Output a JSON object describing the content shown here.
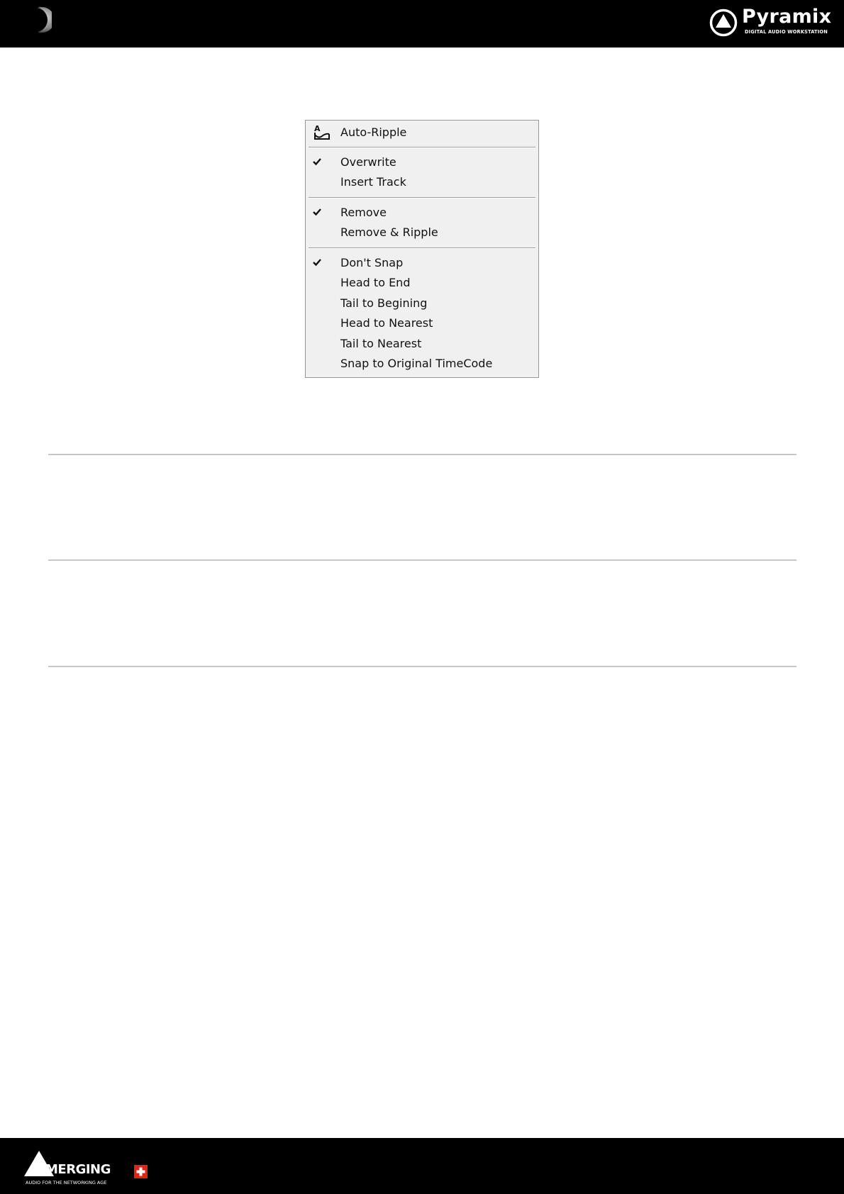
{
  "header": {
    "moon_icon": "moon-icon",
    "logo": {
      "name": "Pyramix",
      "tagline": "DIGITAL AUDIO WORKSTATION",
      "icon": "pyramix-triangle-icon"
    }
  },
  "menu": {
    "items": [
      {
        "label": "Auto-Ripple",
        "checked": false,
        "icon": "auto-ripple-icon"
      },
      {
        "label": "Overwrite",
        "checked": true
      },
      {
        "label": "Insert Track",
        "checked": false
      },
      {
        "label": "Remove",
        "checked": true
      },
      {
        "label": "Remove & Ripple",
        "checked": false
      },
      {
        "label": "Don't Snap",
        "checked": true
      },
      {
        "label": "Head to End",
        "checked": false
      },
      {
        "label": "Tail to Begining",
        "checked": false
      },
      {
        "label": "Head to Nearest",
        "checked": false
      },
      {
        "label": "Tail to Nearest",
        "checked": false
      },
      {
        "label": "Snap to Original TimeCode",
        "checked": false
      }
    ]
  },
  "footer": {
    "logo": {
      "name": "MERGING",
      "tagline": "AUDIO FOR THE NETWORKING AGE",
      "icon": "merging-triangle-icon",
      "flag_icon": "swiss-flag-icon"
    }
  },
  "colors": {
    "header_bg": "#000000",
    "footer_bg": "#000000",
    "menu_bg": "#f0f0f0",
    "menu_border": "#979797",
    "rule": "#c8c8c8",
    "flag_red": "#e2231a"
  }
}
